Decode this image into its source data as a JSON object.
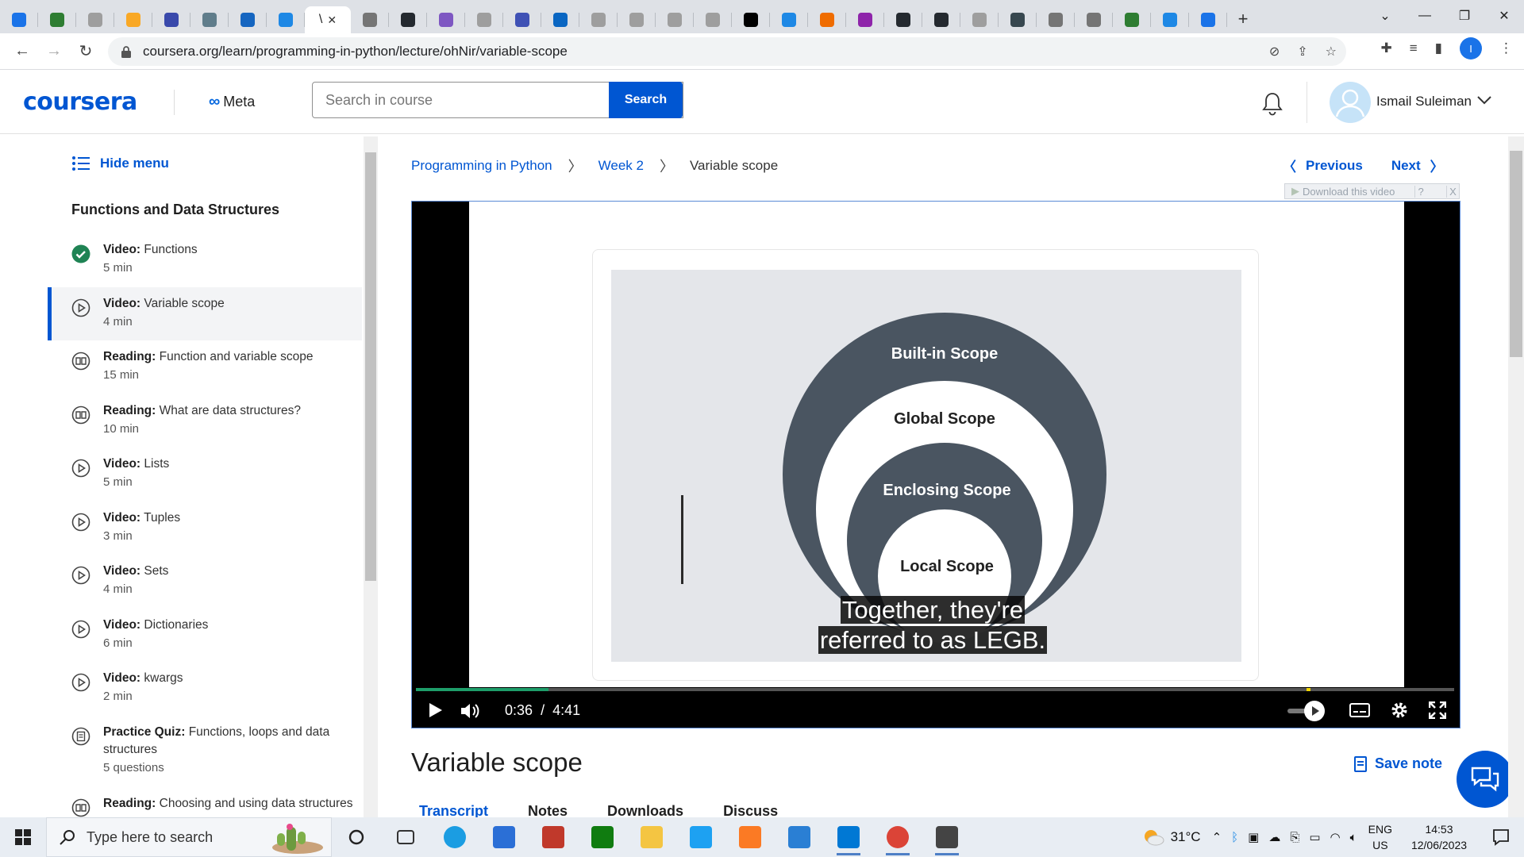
{
  "browser": {
    "tabs": [
      {
        "icon": "download-icon",
        "color": "#1a73e8"
      },
      {
        "icon": "one-icon",
        "color": "#2e7d32"
      },
      {
        "icon": "chart-icon",
        "color": "#9e9e9e"
      },
      {
        "icon": "check-icon",
        "color": "#f9a825"
      },
      {
        "icon": "tool-icon",
        "color": "#3949ab"
      },
      {
        "icon": "cloud-icon",
        "color": "#607d8b"
      },
      {
        "icon": "nook-icon",
        "color": "#1565c0"
      },
      {
        "icon": "c-icon",
        "color": "#1e88e5"
      },
      {
        "icon": "globe-icon",
        "color": "#757575"
      },
      {
        "icon": "github-icon",
        "color": "#24292f"
      },
      {
        "icon": "h-icon",
        "color": "#7e57c2"
      },
      {
        "icon": "globe-icon",
        "color": "#9e9e9e"
      },
      {
        "icon": "php-icon",
        "color": "#3f51b5"
      },
      {
        "icon": "linkedin-icon",
        "color": "#0a66c2"
      },
      {
        "icon": "box-icon",
        "color": "#9e9e9e"
      },
      {
        "icon": "box-icon",
        "color": "#9e9e9e"
      },
      {
        "icon": "box-icon",
        "color": "#9e9e9e"
      },
      {
        "icon": "box-icon",
        "color": "#9e9e9e"
      },
      {
        "icon": "dev-icon",
        "color": "#000000"
      },
      {
        "icon": "c-icon",
        "color": "#1e88e5"
      },
      {
        "icon": "hex-icon",
        "color": "#ef6c00"
      },
      {
        "icon": "u-icon",
        "color": "#8e24aa"
      },
      {
        "icon": "github-icon",
        "color": "#24292f"
      },
      {
        "icon": "github-icon",
        "color": "#24292f"
      },
      {
        "icon": "check-icon",
        "color": "#9e9e9e"
      },
      {
        "icon": "m-icon",
        "color": "#37474f"
      },
      {
        "icon": "globe-icon",
        "color": "#757575"
      },
      {
        "icon": "globe-icon",
        "color": "#757575"
      },
      {
        "icon": "n-icon",
        "color": "#2e7d32"
      },
      {
        "icon": "flag-icon",
        "color": "#1e88e5"
      },
      {
        "icon": "doc-icon",
        "color": "#1a73e8"
      }
    ],
    "active_tab_label": "\\",
    "active_tab_close": "✕",
    "new_tab": "+",
    "url": "coursera.org/learn/programming-in-python/lecture/ohNir/variable-scope",
    "profile_initial": "I"
  },
  "header": {
    "logo": "coursera",
    "partner": "Meta",
    "search_placeholder": "Search in course",
    "search_button": "Search",
    "user_name": "Ismail Suleiman"
  },
  "sidebar": {
    "hide_menu": "Hide menu",
    "section_title": "Functions and Data Structures",
    "items": [
      {
        "type": "Video:",
        "title": "Functions",
        "meta": "5 min",
        "icon": "completed-check-icon",
        "current": false
      },
      {
        "type": "Video:",
        "title": "Variable scope",
        "meta": "4 min",
        "icon": "play-circle-icon",
        "current": true
      },
      {
        "type": "Reading:",
        "title": "Function and variable scope",
        "meta": "15 min",
        "icon": "book-icon",
        "current": false
      },
      {
        "type": "Reading:",
        "title": "What are data structures?",
        "meta": "10 min",
        "icon": "book-icon",
        "current": false
      },
      {
        "type": "Video:",
        "title": "Lists",
        "meta": "5 min",
        "icon": "play-circle-icon",
        "current": false
      },
      {
        "type": "Video:",
        "title": "Tuples",
        "meta": "3 min",
        "icon": "play-circle-icon",
        "current": false
      },
      {
        "type": "Video:",
        "title": "Sets",
        "meta": "4 min",
        "icon": "play-circle-icon",
        "current": false
      },
      {
        "type": "Video:",
        "title": "Dictionaries",
        "meta": "6 min",
        "icon": "play-circle-icon",
        "current": false
      },
      {
        "type": "Video:",
        "title": "kwargs",
        "meta": "2 min",
        "icon": "play-circle-icon",
        "current": false
      },
      {
        "type": "Practice Quiz:",
        "title": "Functions, loops and data structures",
        "meta": "5 questions",
        "icon": "quiz-icon",
        "current": false
      },
      {
        "type": "Reading:",
        "title": "Choosing and using data structures",
        "meta": "",
        "icon": "book-icon",
        "current": false
      }
    ]
  },
  "breadcrumb": {
    "course": "Programming in Python",
    "week": "Week 2",
    "lesson": "Variable scope"
  },
  "nav": {
    "previous": "Previous",
    "next": "Next"
  },
  "download_bar": {
    "label": "Download this video",
    "help": "?",
    "close": "X"
  },
  "video": {
    "scopes": [
      "Built-in Scope",
      "Global Scope",
      "Enclosing Scope",
      "Local Scope"
    ],
    "colors": {
      "dark": "#4a5561",
      "light": "#ffffff",
      "slide_bg": "#e4e6ea"
    },
    "caption_line1": "Together, they're",
    "caption_line2": "referred to as LEGB.",
    "current_time": "0:36",
    "duration": "4:41",
    "played_fraction": 0.128
  },
  "lesson": {
    "title": "Variable scope",
    "save_note": "Save note",
    "tabs": [
      "Transcript",
      "Notes",
      "Downloads",
      "Discuss"
    ]
  },
  "taskbar": {
    "search_placeholder": "Type here to search",
    "apps": [
      "task-view-icon",
      "edge-icon",
      "store-icon",
      "app-icon",
      "xbox-icon",
      "file-explorer-icon",
      "twitter-icon",
      "xampp-icon",
      "mail-icon",
      "vscode-icon",
      "chrome-icon",
      "settings-icon"
    ],
    "weather": "31°C",
    "lang_line1": "ENG",
    "lang_line2": "US",
    "time": "14:53",
    "date": "12/06/2023"
  },
  "accent": "#0056d2"
}
